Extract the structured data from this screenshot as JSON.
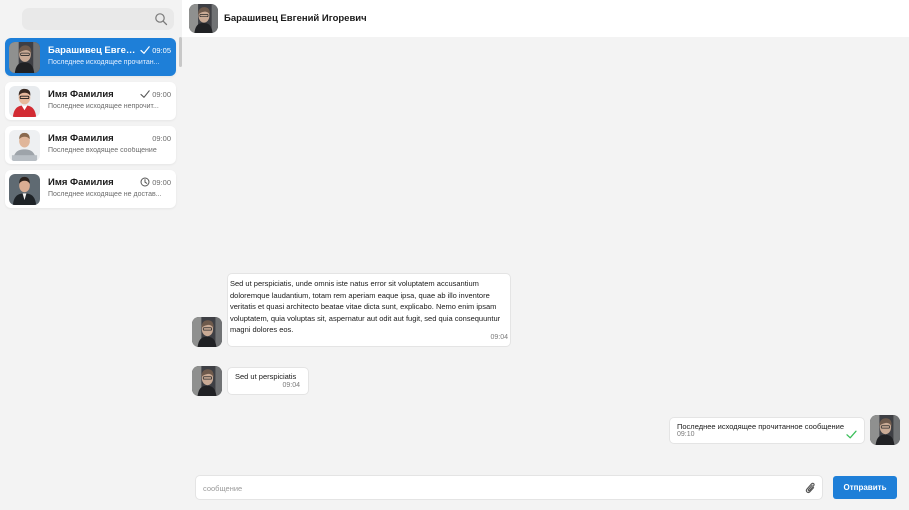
{
  "search": {
    "placeholder": ""
  },
  "chats": [
    {
      "name": "Барашивец Евген...",
      "preview": "Последнее исходящее прочитан...",
      "time": "09:05",
      "status": "read-check-icon"
    },
    {
      "name": "Имя Фамилия",
      "preview": "Последнее исходящее непрочит...",
      "time": "09:00",
      "status": "sent-check-icon"
    },
    {
      "name": "Имя Фамилия",
      "preview": "Последнее входящее сообщение",
      "time": "09:00",
      "status": ""
    },
    {
      "name": "Имя Фамилия",
      "preview": "Последнее исходящее не достав...",
      "time": "09:00",
      "status": "clock-icon"
    }
  ],
  "header": {
    "name": "Барашивец Евгений Игоревич"
  },
  "messages": [
    {
      "text": "Sed ut perspiciatis, unde omnis iste natus error sit voluptatem accusantium doloremque laudantium, totam rem aperiam eaque ipsa, quae ab illo inventore veritatis et quasi architecto beatae vitae dicta sunt, explicabo. Nemo enim ipsam voluptatem, quia voluptas sit, aspernatur aut odit aut fugit, sed quia consequuntur magni dolores eos.",
      "time": "09:04",
      "direction": "incoming"
    },
    {
      "text": "Sed ut perspiciatis",
      "time": "09:04",
      "direction": "incoming"
    },
    {
      "text": "Последнее исходящее прочитанное сообщение",
      "time": "09:10",
      "direction": "outgoing"
    }
  ],
  "composer": {
    "placeholder": "сообщение",
    "value": "",
    "send_label": "Отправить"
  },
  "colors": {
    "accent": "#1e7fd8",
    "read_check": "#3bbf5a",
    "background": "#f3f3f3"
  }
}
